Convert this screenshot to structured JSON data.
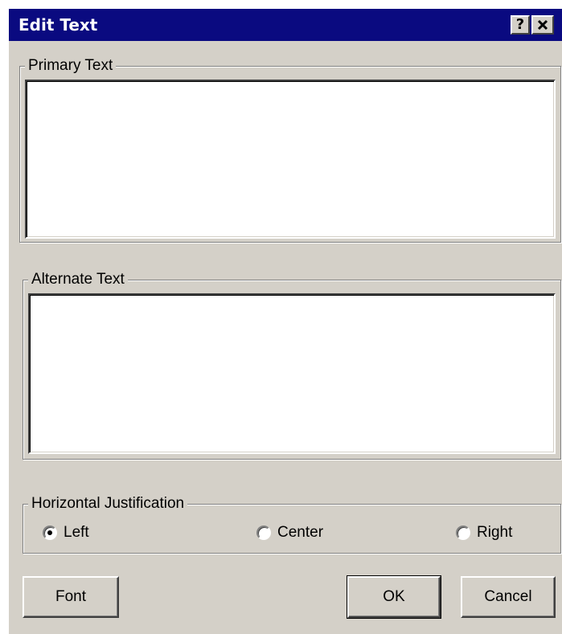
{
  "window": {
    "title": "Edit Text",
    "help_glyph": "?",
    "icons": {
      "help": "question-icon",
      "close": "close-icon"
    },
    "colors": {
      "titlebar": "#0a0a80",
      "face": "#d4d0c8"
    }
  },
  "primary": {
    "label": "Primary Text",
    "value": ""
  },
  "alternate": {
    "label": "Alternate Text",
    "value": ""
  },
  "justification": {
    "label": "Horizontal Justification",
    "selected": "Left",
    "options": {
      "left": "Left",
      "center": "Center",
      "right": "Right"
    }
  },
  "buttons": {
    "font": "Font",
    "ok": "OK",
    "cancel": "Cancel"
  }
}
